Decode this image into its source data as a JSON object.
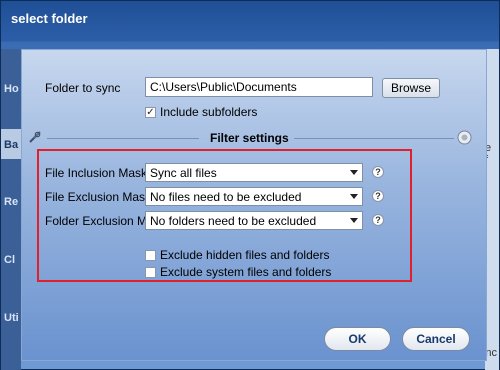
{
  "background": {
    "sidebar_items": [
      "Ho",
      "Ba",
      "Re",
      "Cl",
      "Uti"
    ],
    "right_items": [
      "e f",
      "ync"
    ]
  },
  "dialog": {
    "title": "select folder",
    "folder_to_sync_label": "Folder to sync",
    "folder_path": "C:\\Users\\Public\\Documents",
    "browse_label": "Browse",
    "include_subfolders_label": "Include subfolders",
    "include_subfolders_checked": "✓",
    "filter_settings_title": "Filter settings",
    "file_inclusion_label": "File Inclusion Mask",
    "file_inclusion_value": "Sync all files",
    "file_exclusion_label": "File Exclusion Mask",
    "file_exclusion_value": "No files need to be excluded",
    "folder_exclusion_label": "Folder Exclusion Mask",
    "folder_exclusion_value": "No folders need to be excluded",
    "help_glyph": "?",
    "exclude_hidden_label": "Exclude hidden files and folders",
    "exclude_system_label": "Exclude system files and folders",
    "ok_label": "OK",
    "cancel_label": "Cancel"
  },
  "icons": {
    "filter_left": "wrench-icon",
    "filter_right": "gear-icon"
  },
  "colors": {
    "highlight": "#e0202a"
  }
}
